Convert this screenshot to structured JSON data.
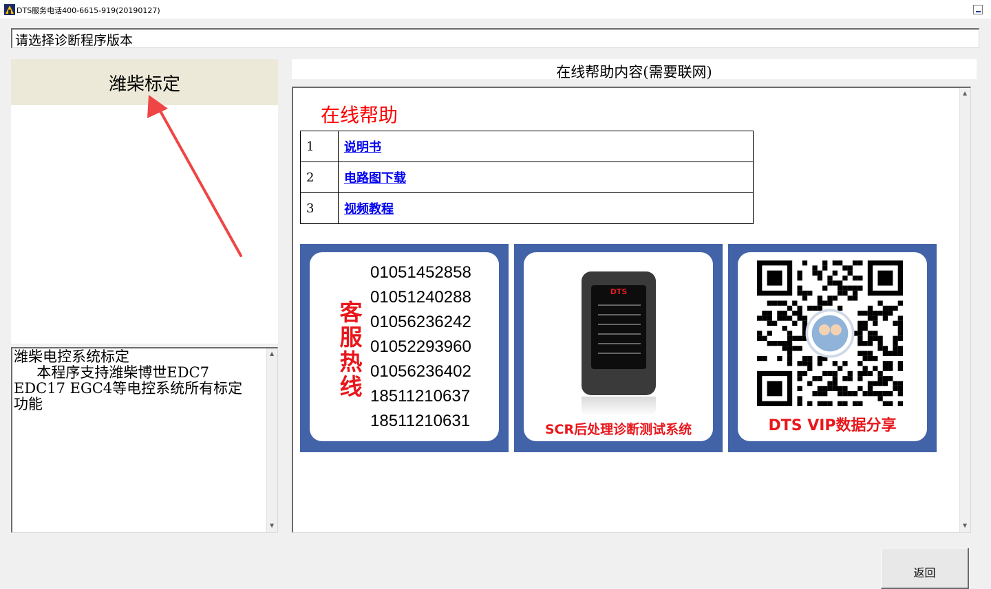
{
  "window": {
    "title": "DTS服务电话400-6615-919(20190127)"
  },
  "version_prompt": "请选择诊断程序版本",
  "program_list": {
    "items": [
      {
        "label": "潍柴标定",
        "selected": true
      }
    ]
  },
  "description": "潍柴电控系统标定\n     本程序支持潍柴博世EDC7\nEDC17 EGC4等电控系统所有标定\n功能",
  "help": {
    "header": "在线帮助内容(需要联网)",
    "title": "在线帮助",
    "rows": [
      {
        "num": "1",
        "link": "说明书"
      },
      {
        "num": "2",
        "link": "电路图下载"
      },
      {
        "num": "3",
        "link": "视频教程"
      }
    ],
    "banners": {
      "hotline": {
        "label": "客服热线",
        "phones": [
          "01051452858",
          "01051240288",
          "01056236242",
          "01052293960",
          "01056236402",
          "18511210637",
          "18511210631"
        ]
      },
      "device": {
        "brand": "DTS",
        "caption": "SCR后处理诊断测试系统"
      },
      "qr": {
        "caption": "DTS  VIP数据分享"
      }
    }
  },
  "buttons": {
    "return_label": "返回"
  },
  "colors": {
    "banner_blue": "#4263a8",
    "accent_red": "#e8171c",
    "link_blue": "#0000ee",
    "selected_item_bg": "#ece9d8"
  }
}
